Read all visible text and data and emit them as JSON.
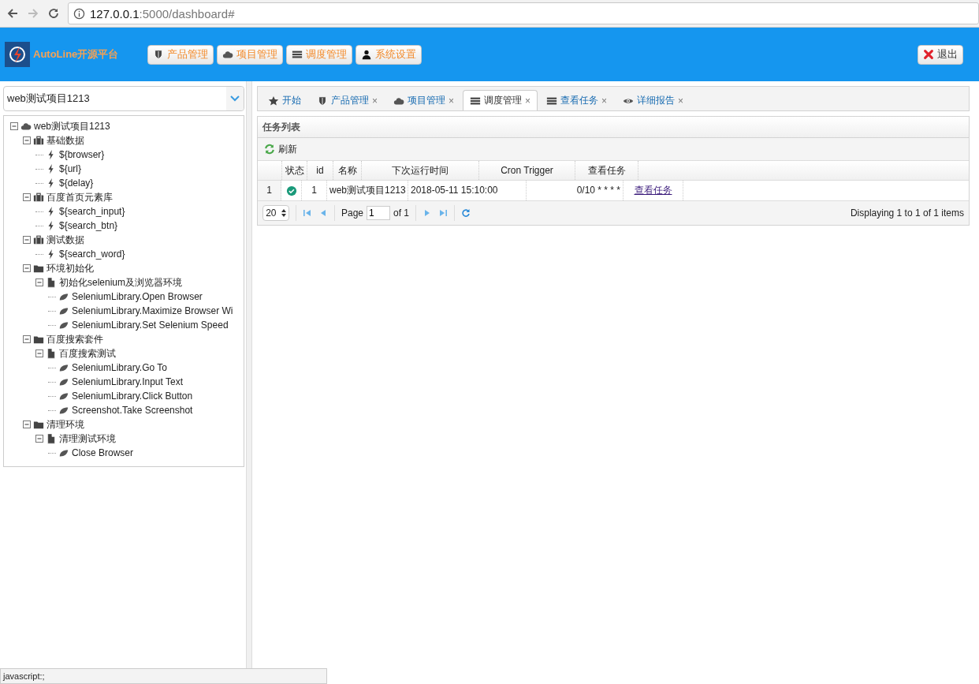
{
  "browser": {
    "address_host": "127.0.0.1",
    "address_path": ":5000/dashboard#"
  },
  "header": {
    "app_name": "AutoLine开源平台",
    "nav": [
      {
        "label": "产品管理",
        "kind": "shield"
      },
      {
        "label": "项目管理",
        "kind": "cloud"
      },
      {
        "label": "调度管理",
        "kind": "list"
      },
      {
        "label": "系统设置",
        "kind": "user"
      }
    ],
    "logout": "退出"
  },
  "sidebar": {
    "project_select": "web测试项目1213",
    "tree": [
      {
        "label": "web测试项目1213",
        "kind": "cloud",
        "expanded": true,
        "children": [
          {
            "label": "基础数据",
            "kind": "case",
            "expanded": true,
            "children": [
              {
                "label": "${browser}",
                "kind": "bolt"
              },
              {
                "label": "${url}",
                "kind": "bolt"
              },
              {
                "label": "${delay}",
                "kind": "bolt"
              }
            ]
          },
          {
            "label": "百度首页元素库",
            "kind": "case",
            "expanded": true,
            "children": [
              {
                "label": "${search_input}",
                "kind": "bolt"
              },
              {
                "label": "${search_btn}",
                "kind": "bolt"
              }
            ]
          },
          {
            "label": "测试数据",
            "kind": "case",
            "expanded": true,
            "children": [
              {
                "label": "${search_word}",
                "kind": "bolt"
              }
            ]
          },
          {
            "label": "环境初始化",
            "kind": "folder",
            "expanded": true,
            "children": [
              {
                "label": "初始化selenium及浏览器环境",
                "kind": "file",
                "expanded": true,
                "children": [
                  {
                    "label": "SeleniumLibrary.Open Browser",
                    "kind": "leaf"
                  },
                  {
                    "label": "SeleniumLibrary.Maximize Browser Wi",
                    "kind": "leaf"
                  },
                  {
                    "label": "SeleniumLibrary.Set Selenium Speed",
                    "kind": "leaf"
                  }
                ]
              }
            ]
          },
          {
            "label": "百度搜索套件",
            "kind": "folder",
            "expanded": true,
            "children": [
              {
                "label": "百度搜索测试",
                "kind": "file",
                "expanded": true,
                "children": [
                  {
                    "label": "SeleniumLibrary.Go To",
                    "kind": "leaf"
                  },
                  {
                    "label": "SeleniumLibrary.Input Text",
                    "kind": "leaf"
                  },
                  {
                    "label": "SeleniumLibrary.Click Button",
                    "kind": "leaf"
                  },
                  {
                    "label": "Screenshot.Take Screenshot",
                    "kind": "leaf"
                  }
                ]
              }
            ]
          },
          {
            "label": "清理环境",
            "kind": "folder",
            "expanded": true,
            "children": [
              {
                "label": "清理测试环境",
                "kind": "file",
                "expanded": true,
                "children": [
                  {
                    "label": "Close Browser",
                    "kind": "leaf"
                  }
                ]
              }
            ]
          }
        ]
      }
    ]
  },
  "tabs": [
    {
      "label": "开始",
      "kind": "star",
      "selected": false
    },
    {
      "label": "产品管理",
      "kind": "shield",
      "close": "×",
      "selected": false
    },
    {
      "label": "项目管理",
      "kind": "cloud",
      "close": "×",
      "selected": false
    },
    {
      "label": "调度管理",
      "kind": "list",
      "close": "×",
      "selected": true
    },
    {
      "label": "查看任务",
      "kind": "list",
      "close": "×",
      "selected": false
    },
    {
      "label": "详细报告",
      "kind": "eye",
      "close": "×",
      "selected": false
    }
  ],
  "panel": {
    "title": "任务列表",
    "refresh": "刷新",
    "columns": [
      "状态",
      "id",
      "名称",
      "下次运行时间",
      "Cron Trigger",
      "查看任务"
    ],
    "rows": [
      {
        "number": "1",
        "running": true,
        "id": "1",
        "name": "web测试项目1213",
        "next_run": "2018-05-11 15:10:00",
        "cron": "0/10 * * * *",
        "link": "查看任务"
      }
    ],
    "pager": {
      "page_size": "20",
      "page_label": "Page",
      "page": "1",
      "of": "of 1",
      "summary": "Displaying 1 to 1 of 1 items"
    }
  },
  "status_bar": "javascript:;"
}
